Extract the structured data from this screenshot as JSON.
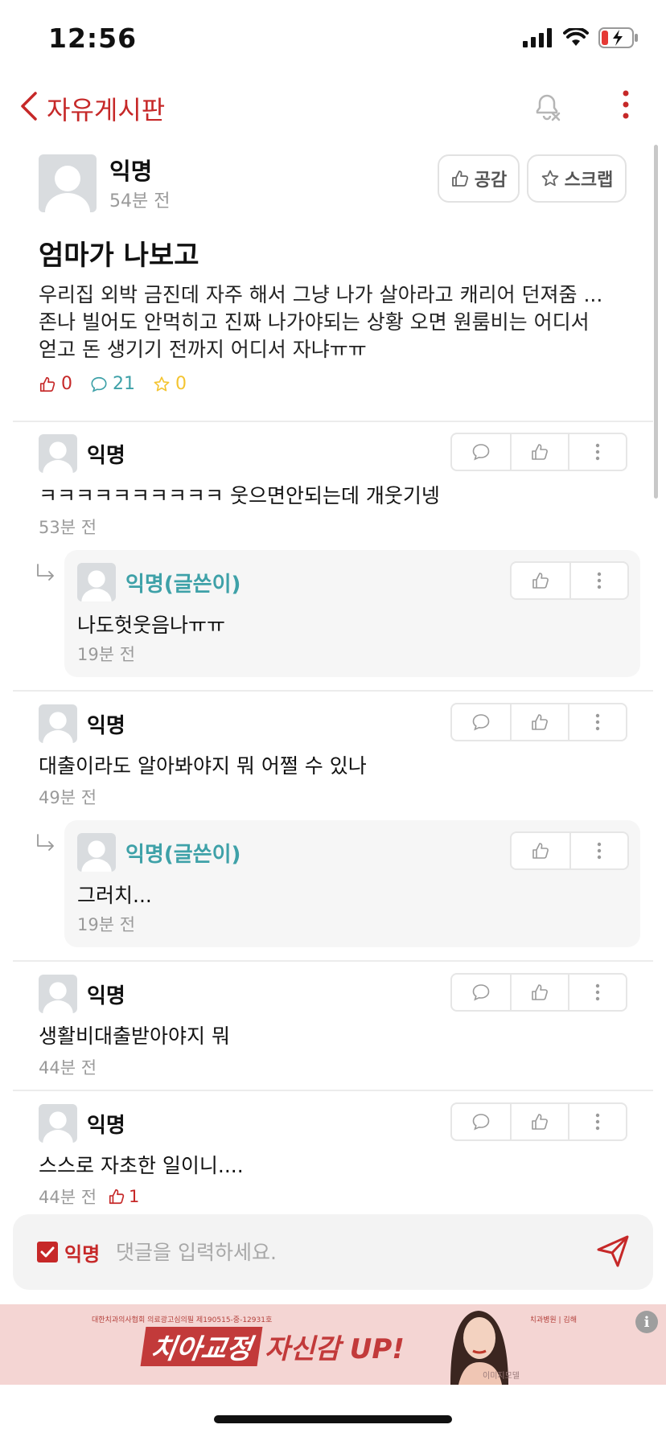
{
  "status_bar": {
    "time": "12:56"
  },
  "nav": {
    "title": "자유게시판"
  },
  "post": {
    "author": "익명",
    "time": "54분 전",
    "like_button_label": "공감",
    "scrap_button_label": "스크랩",
    "title": "엄마가 나보고",
    "body_line1": "우리집 외박 금진데 자주 해서 그냥 나가 살아라고 캐리어 던져줌 ...",
    "body_line2": "존나 빌어도 안먹히고 진짜 나가야되는 상황 오면 원룸비는 어디서",
    "body_line3": "얻고 돈 생기기 전까지 어디서 자냐ㅠㅠ",
    "likes": "0",
    "comments": "21",
    "scraps": "0"
  },
  "comments": [
    {
      "author": "익명",
      "text": "ㅋㅋㅋㅋㅋㅋㅋㅋㅋㅋ 웃으면안되는데 개웃기넹",
      "time": "53분 전",
      "reply": {
        "author": "익명(글쓴이)",
        "text": "나도헛웃음나ㅠㅠ",
        "time": "19분 전"
      }
    },
    {
      "author": "익명",
      "text": "대출이라도 알아봐야지 뭐 어쩔 수 있나",
      "time": "49분 전",
      "reply": {
        "author": "익명(글쓴이)",
        "text": "그러치...",
        "time": "19분 전"
      }
    },
    {
      "author": "익명",
      "text": "생활비대출받아야지 뭐",
      "time": "44분 전"
    },
    {
      "author": "익명",
      "text": "스스로 자초한 일이니....",
      "time": "44분 전",
      "likes": "1"
    }
  ],
  "input_bar": {
    "anon_label": "익명",
    "placeholder": "댓글을 입력하세요."
  },
  "ad": {
    "small_left": "대한치과의사협회 의료광고심의필 제190515-중-12931호",
    "small_right": "뉴욕치과병원 | 김해",
    "headline_part1": "치아교정",
    "headline_part2": "자신감 UP!",
    "caption": "이미지모델",
    "info": "i"
  },
  "colors": {
    "accent": "#c62828",
    "op_author": "#3ea1a8",
    "comment_icon": "#3ea1a8",
    "scrap_icon": "#f4c430"
  }
}
